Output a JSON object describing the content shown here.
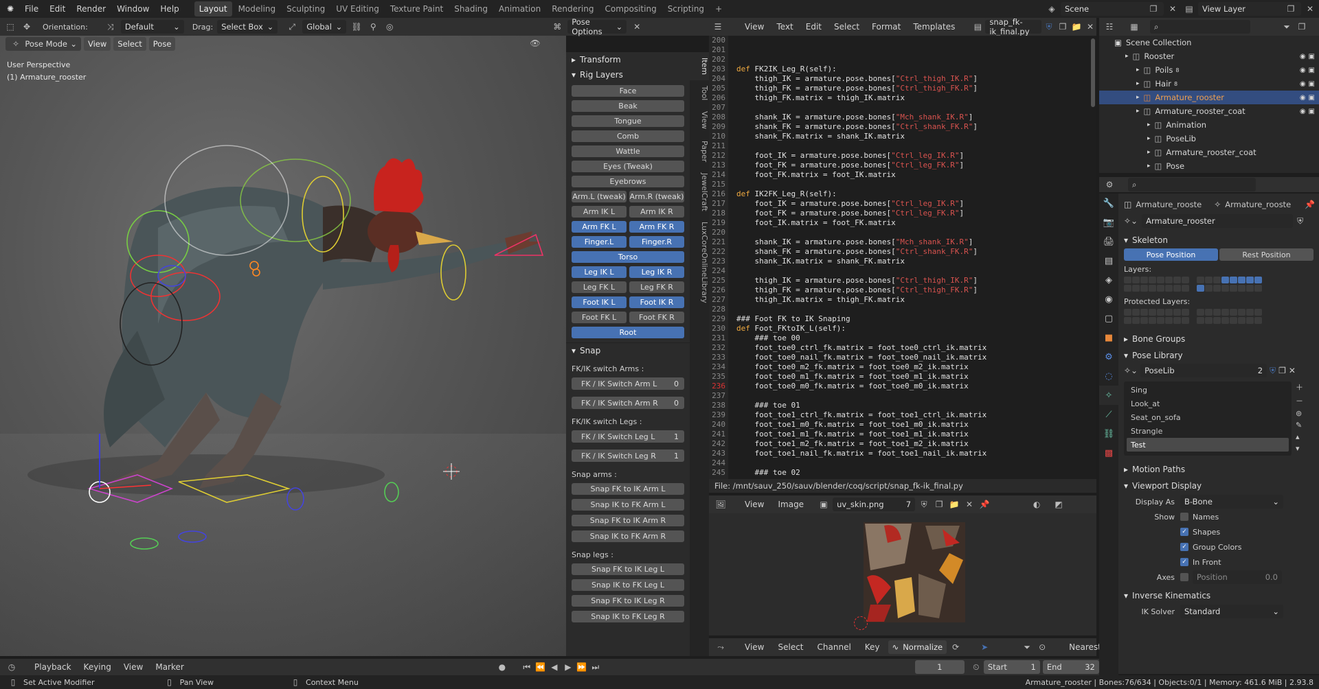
{
  "topbar": {
    "menus": [
      "File",
      "Edit",
      "Render",
      "Window",
      "Help"
    ],
    "workspaces": [
      "Layout",
      "Modeling",
      "Sculpting",
      "UV Editing",
      "Texture Paint",
      "Shading",
      "Animation",
      "Rendering",
      "Compositing",
      "Scripting"
    ],
    "active_workspace": "Layout",
    "add_tab": "+",
    "scene_name": "Scene",
    "view_layer": "View Layer"
  },
  "viewport": {
    "orientation_label": "Orientation:",
    "orientation_value": "Default",
    "drag_label": "Drag:",
    "drag_value": "Select Box",
    "transform_space": "Global",
    "pose_options": "Pose Options",
    "mode": "Pose Mode",
    "menus": [
      "View",
      "Select",
      "Pose"
    ],
    "overlay_perspective": "User Perspective",
    "overlay_object": "(1) Armature_rooster"
  },
  "npanel": {
    "tabs": [
      "Item",
      "Tool",
      "View",
      "Paper",
      "JewelCraft",
      "LuxCoreOnlineLibrary"
    ],
    "transform_header": "Transform",
    "rig_layers_header": "Rig Layers",
    "rig_single": [
      {
        "label": "Face",
        "on": false
      },
      {
        "label": "Beak",
        "on": false
      },
      {
        "label": "Tongue",
        "on": false
      },
      {
        "label": "Comb",
        "on": false
      },
      {
        "label": "Wattle",
        "on": false
      },
      {
        "label": "Eyes (Tweak)",
        "on": false
      },
      {
        "label": "Eyebrows",
        "on": false
      }
    ],
    "rig_pairs": [
      [
        {
          "label": "Arm.L (tweak)",
          "on": false
        },
        {
          "label": "Arm.R (tweak)",
          "on": false
        }
      ],
      [
        {
          "label": "Arm IK L",
          "on": false
        },
        {
          "label": "Arm IK R",
          "on": false
        }
      ],
      [
        {
          "label": "Arm FK L",
          "on": true
        },
        {
          "label": "Arm FK R",
          "on": true
        }
      ],
      [
        {
          "label": "Finger.L",
          "on": true
        },
        {
          "label": "Finger.R",
          "on": true
        }
      ]
    ],
    "torso": "Torso",
    "rig_pairs2": [
      [
        {
          "label": "Leg IK L",
          "on": true
        },
        {
          "label": "Leg IK R",
          "on": true
        }
      ],
      [
        {
          "label": "Leg FK L",
          "on": false
        },
        {
          "label": "Leg FK R",
          "on": false
        }
      ],
      [
        {
          "label": "Foot IK L",
          "on": true
        },
        {
          "label": "Foot IK R",
          "on": true
        }
      ],
      [
        {
          "label": "Foot FK L",
          "on": false
        },
        {
          "label": "Foot FK R",
          "on": false
        }
      ]
    ],
    "root": "Root",
    "snap_header": "Snap",
    "fkik_arms_label": "FK/IK switch Arms :",
    "switch_arm_l": "FK / IK Switch Arm L",
    "switch_arm_l_val": "0",
    "switch_arm_r": "FK / IK Switch Arm R",
    "switch_arm_r_val": "0",
    "fkik_legs_label": "FK/IK switch Legs :",
    "switch_leg_l": "FK / IK Switch Leg L",
    "switch_leg_l_val": "1",
    "switch_leg_r": "FK / IK Switch Leg R",
    "switch_leg_r_val": "1",
    "snap_arms_label": "Snap arms :",
    "snap_arms": [
      "Snap FK to IK Arm L",
      "Snap IK to FK Arm L",
      "Snap FK to IK Arm R",
      "Snap IK to FK Arm R"
    ],
    "snap_legs_label": "Snap legs :",
    "snap_legs": [
      "Snap FK to IK Leg L",
      "Snap IK to FK Leg L",
      "Snap FK to IK Leg R",
      "Snap IK to FK Leg R"
    ]
  },
  "text_editor": {
    "menus": [
      "View",
      "Text",
      "Edit",
      "Select",
      "Format",
      "Templates"
    ],
    "filename": "snap_fk-ik_final.py",
    "file_path": "File: /mnt/sauv_250/sauv/blender/coq/script/snap_fk-ik_final.py",
    "error_line": "236",
    "lines": [
      {
        "n": "200",
        "code": ""
      },
      {
        "n": "201",
        "code": ""
      },
      {
        "n": "202",
        "code": ""
      },
      {
        "n": "203",
        "code": "def FK2IK_Leg_R(self):"
      },
      {
        "n": "204",
        "code": "    thigh_IK = armature.pose.bones[\"Ctrl_thigh_IK.R\"]"
      },
      {
        "n": "205",
        "code": "    thigh_FK = armature.pose.bones[\"Ctrl_thigh_FK.R\"]"
      },
      {
        "n": "206",
        "code": "    thigh_FK.matrix = thigh_IK.matrix"
      },
      {
        "n": "207",
        "code": ""
      },
      {
        "n": "208",
        "code": "    shank_IK = armature.pose.bones[\"Mch_shank_IK.R\"]"
      },
      {
        "n": "209",
        "code": "    shank_FK = armature.pose.bones[\"Ctrl_shank_FK.R\"]"
      },
      {
        "n": "210",
        "code": "    shank_FK.matrix = shank_IK.matrix"
      },
      {
        "n": "211",
        "code": ""
      },
      {
        "n": "212",
        "code": "    foot_IK = armature.pose.bones[\"Ctrl_leg_IK.R\"]"
      },
      {
        "n": "213",
        "code": "    foot_FK = armature.pose.bones[\"Ctrl_leg_FK.R\"]"
      },
      {
        "n": "214",
        "code": "    foot_FK.matrix = foot_IK.matrix"
      },
      {
        "n": "215",
        "code": ""
      },
      {
        "n": "216",
        "code": "def IK2FK_Leg_R(self):"
      },
      {
        "n": "217",
        "code": "    foot_IK = armature.pose.bones[\"Ctrl_leg_IK.R\"]"
      },
      {
        "n": "218",
        "code": "    foot_FK = armature.pose.bones[\"Ctrl_leg_FK.R\"]"
      },
      {
        "n": "219",
        "code": "    foot_IK.matrix = foot_FK.matrix"
      },
      {
        "n": "220",
        "code": ""
      },
      {
        "n": "221",
        "code": "    shank_IK = armature.pose.bones[\"Mch_shank_IK.R\"]"
      },
      {
        "n": "222",
        "code": "    shank_FK = armature.pose.bones[\"Ctrl_shank_FK.R\"]"
      },
      {
        "n": "223",
        "code": "    shank_IK.matrix = shank_FK.matrix"
      },
      {
        "n": "224",
        "code": ""
      },
      {
        "n": "225",
        "code": "    thigh_IK = armature.pose.bones[\"Ctrl_thigh_IK.R\"]"
      },
      {
        "n": "226",
        "code": "    thigh_FK = armature.pose.bones[\"Ctrl_thigh_FK.R\"]"
      },
      {
        "n": "227",
        "code": "    thigh_IK.matrix = thigh_FK.matrix"
      },
      {
        "n": "228",
        "code": ""
      },
      {
        "n": "229",
        "code": "### Foot FK to IK Snaping"
      },
      {
        "n": "230",
        "code": "def Foot_FKtoIK_L(self):"
      },
      {
        "n": "231",
        "code": "    ### toe 00"
      },
      {
        "n": "232",
        "code": "    foot_toe0_ctrl_fk.matrix = foot_toe0_ctrl_ik.matrix"
      },
      {
        "n": "233",
        "code": "    foot_toe0_nail_fk.matrix = foot_toe0_nail_ik.matrix"
      },
      {
        "n": "234",
        "code": "    foot_toe0_m2_fk.matrix = foot_toe0_m2_ik.matrix"
      },
      {
        "n": "235",
        "code": "    foot_toe0_m1_fk.matrix = foot_toe0_m1_ik.matrix"
      },
      {
        "n": "236",
        "code": "    foot_toe0_m0_fk.matrix = foot_toe0_m0_ik.matrix"
      },
      {
        "n": "237",
        "code": ""
      },
      {
        "n": "238",
        "code": "    ### toe 01"
      },
      {
        "n": "239",
        "code": "    foot_toe1_ctrl_fk.matrix = foot_toe1_ctrl_ik.matrix"
      },
      {
        "n": "240",
        "code": "    foot_toe1_m0_fk.matrix = foot_toe1_m0_ik.matrix"
      },
      {
        "n": "241",
        "code": "    foot_toe1_m1_fk.matrix = foot_toe1_m1_ik.matrix"
      },
      {
        "n": "242",
        "code": "    foot_toe1_m2_fk.matrix = foot_toe1_m2_ik.matrix"
      },
      {
        "n": "243",
        "code": "    foot_toe1_nail_fk.matrix = foot_toe1_nail_ik.matrix"
      },
      {
        "n": "244",
        "code": ""
      },
      {
        "n": "245",
        "code": "    ### toe 02"
      }
    ]
  },
  "image_editor": {
    "menus": [
      "View",
      "Image"
    ],
    "image_name": "uv_skin.png",
    "users": "7"
  },
  "graph_header": {
    "menus": [
      "View",
      "Select",
      "Channel",
      "Key"
    ],
    "normalize": "Normalize",
    "interpolation": "Nearest"
  },
  "outliner": {
    "collection": "Scene Collection",
    "items": [
      {
        "label": "Rooster",
        "indent": 1,
        "sel": false
      },
      {
        "label": "Poils",
        "indent": 2,
        "sel": false,
        "badge": "8"
      },
      {
        "label": "Hair",
        "indent": 2,
        "sel": false,
        "badge": "8"
      },
      {
        "label": "Armature_rooster",
        "indent": 2,
        "sel": true
      },
      {
        "label": "Armature_rooster_coat",
        "indent": 2,
        "sel": false
      },
      {
        "label": "Animation",
        "indent": 3,
        "sel": false
      },
      {
        "label": "PoseLib",
        "indent": 3,
        "sel": false
      },
      {
        "label": "Armature_rooster_coat",
        "indent": 3,
        "sel": false
      },
      {
        "label": "Pose",
        "indent": 3,
        "sel": false
      }
    ]
  },
  "properties": {
    "breadcrumb_a": "Armature_rooste",
    "breadcrumb_b": "Armature_rooste",
    "data_name": "Armature_rooster",
    "skeleton_header": "Skeleton",
    "pose_position": "Pose Position",
    "rest_position": "Rest Position",
    "layers_label": "Layers:",
    "protected_layers_label": "Protected Layers:",
    "bone_groups": "Bone Groups",
    "pose_library": "Pose Library",
    "poselib_name": "PoseLib",
    "poselib_users": "2",
    "poses": [
      "Sing",
      "Look_at",
      "Seat_on_sofa",
      "Strangle",
      "Test"
    ],
    "active_pose": "Test",
    "motion_paths": "Motion Paths",
    "viewport_display": "Viewport Display",
    "display_as_label": "Display As",
    "display_as_value": "B-Bone",
    "show_label": "Show",
    "show_names": "Names",
    "show_shapes": "Shapes",
    "show_group_colors": "Group Colors",
    "show_in_front": "In Front",
    "axes_label": "Axes",
    "axes_position": "Position",
    "axes_value": "0.0",
    "inverse_kinematics": "Inverse Kinematics",
    "ik_solver_label": "IK Solver",
    "ik_solver_value": "Standard"
  },
  "timeline": {
    "menus": [
      "Playback",
      "Keying",
      "View",
      "Marker"
    ],
    "current_frame": "1",
    "start_label": "Start",
    "start_value": "1",
    "end_label": "End",
    "end_value": "32"
  },
  "status": {
    "left1": "Set Active Modifier",
    "left2": "Pan View",
    "left3": "Context Menu",
    "right": "Armature_rooster | Bones:76/634 | Objects:0/1 | Memory: 461.6 MiB | 2.93.8"
  },
  "colors": {
    "accent": "#4772b3",
    "selected_row": "#334d80",
    "error_line": "#d33333"
  }
}
